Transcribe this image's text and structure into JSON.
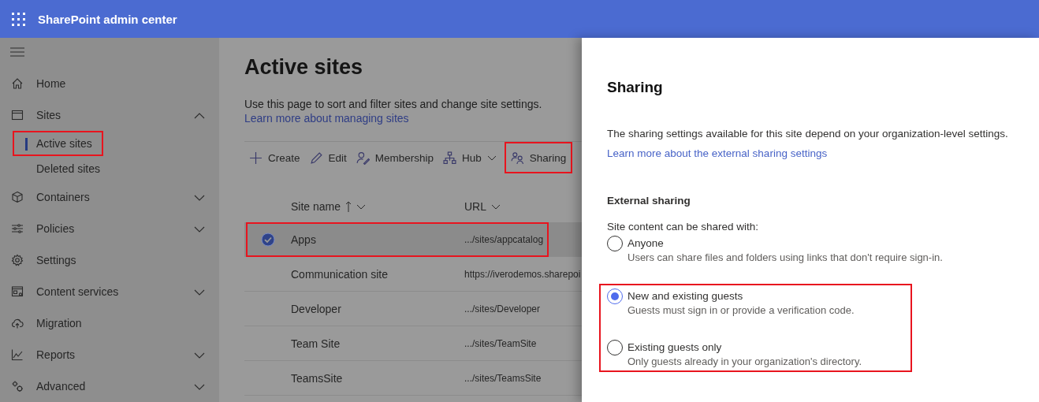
{
  "app_bar": {
    "title": "SharePoint admin center"
  },
  "nav": {
    "items": [
      {
        "label": "Home"
      },
      {
        "label": "Sites",
        "expanded": true,
        "children": [
          {
            "label": "Active sites",
            "selected": true,
            "highlighted": true
          },
          {
            "label": "Deleted sites",
            "selected": false,
            "highlighted": false
          }
        ]
      },
      {
        "label": "Containers",
        "expanded": false
      },
      {
        "label": "Policies",
        "expanded": false
      },
      {
        "label": "Settings"
      },
      {
        "label": "Content services",
        "expanded": false
      },
      {
        "label": "Migration"
      },
      {
        "label": "Reports",
        "expanded": false
      },
      {
        "label": "Advanced",
        "expanded": false
      }
    ]
  },
  "page": {
    "title": "Active sites",
    "description": "Use this page to sort and filter sites and change site settings.",
    "link": "Learn more about managing sites",
    "toolbar": [
      {
        "label": "Create",
        "highlighted": false
      },
      {
        "label": "Edit",
        "highlighted": false
      },
      {
        "label": "Membership",
        "highlighted": false
      },
      {
        "label": "Hub",
        "menu": true,
        "highlighted": false
      },
      {
        "label": "Sharing",
        "highlighted": true
      }
    ],
    "table": {
      "columns": [
        {
          "label": "Site name",
          "sorted": true,
          "ascending": true
        },
        {
          "label": "URL"
        }
      ],
      "rows": [
        {
          "name": "Apps",
          "url": ".../sites/appcatalog",
          "selected": true,
          "highlighted": true
        },
        {
          "name": "Communication site",
          "url": "https://iverodemos.sharepoi",
          "selected": false,
          "highlighted": false
        },
        {
          "name": "Developer",
          "url": ".../sites/Developer",
          "selected": false,
          "highlighted": false
        },
        {
          "name": "Team Site",
          "url": ".../sites/TeamSite",
          "selected": false,
          "highlighted": false
        },
        {
          "name": "TeamsSite",
          "url": ".../sites/TeamsSite",
          "selected": false,
          "highlighted": false
        }
      ]
    }
  },
  "panel": {
    "title": "Sharing",
    "description": "The sharing settings available for this site depend on your organization-level settings.",
    "link": "Learn more about the external sharing settings",
    "section": "External sharing",
    "prompt": "Site content can be shared with:",
    "options": [
      {
        "label": "Anyone",
        "description": "Users can share files and folders using links that don't require sign-in.",
        "selected": false,
        "highlighted": false
      },
      {
        "label": "New and existing guests",
        "description": "Guests must sign in or provide a verification code.",
        "selected": true,
        "highlighted": true
      },
      {
        "label": "Existing guests only",
        "description": "Only guests already in your organization's directory.",
        "selected": false,
        "highlighted": true
      }
    ]
  }
}
